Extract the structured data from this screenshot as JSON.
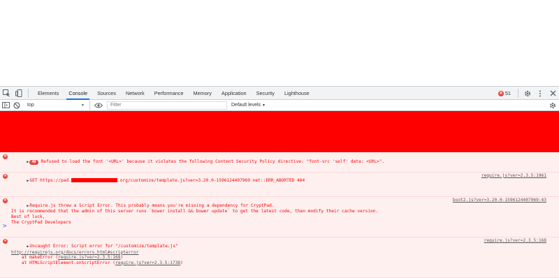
{
  "tabs": [
    "Elements",
    "Console",
    "Sources",
    "Network",
    "Performance",
    "Memory",
    "Application",
    "Security",
    "Lighthouse"
  ],
  "active_tab": "Console",
  "error_count": "51",
  "toolbar": {
    "context": "top",
    "filter_placeholder": "Filter",
    "levels": "Default levels"
  },
  "colors": {
    "banner": "#ff0000",
    "accent": "#1a73e8",
    "error": "#e8453c"
  },
  "messages": [
    {
      "badge": "48",
      "text": "Refused to load the font '<URL>' because it violates the following Content Security Policy directive: \"font-src 'self' data: <URL>\"."
    },
    {
      "pre": "GET https://pad.",
      "post": ".org/customize/template.js?ver=3.20.0-1596124407969 net::ERR_ABORTED 404",
      "source": "require.js?ver=2.3.5:1961"
    },
    {
      "lines": [
        "Require.js threw a Script Error. This probably means you're missing a dependency for CryptPad.",
        "It is recommended that the admin of this server runs `bower install && bower update` to get the latest code, then modify their cache version.",
        "Best of luck,",
        "The CryptPad Developers"
      ],
      "source": "boot2.js?ver=3.20.0-1596124407969:43"
    },
    {
      "line1": "Uncaught Error: Script error for \"/customize/template.js\"",
      "link": "http://requirejs.org/docs/errors.html#scripterror",
      "stack1_pre": "    at makeError (",
      "stack1_link": "require.js?ver=2.3.5:168",
      "stack1_post": ")",
      "stack2_pre": "    at HTMLScriptElement.onScriptError (",
      "stack2_link": "require.js?ver=2.3.5:1738",
      "stack2_post": ")",
      "source": "require.js?ver=2.3.5:168"
    }
  ],
  "prompt": ">"
}
